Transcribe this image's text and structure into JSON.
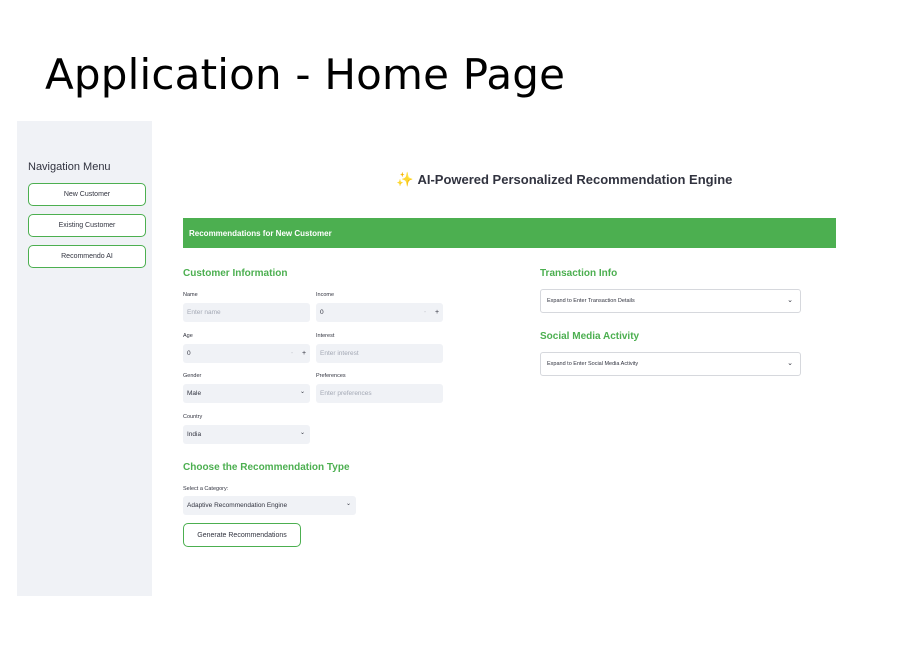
{
  "slide": {
    "title": "Application - Home Page"
  },
  "sidebar": {
    "heading": "Navigation Menu",
    "items": [
      {
        "label": "New Customer"
      },
      {
        "label": "Existing Customer"
      },
      {
        "label": "Recommendo AI"
      }
    ]
  },
  "header": {
    "sparkle": "✨",
    "title": "AI-Powered Personalized Recommendation Engine"
  },
  "banner": {
    "text": "Recommendations for New Customer"
  },
  "customer_info": {
    "title": "Customer Information",
    "name": {
      "label": "Name",
      "placeholder": "Enter name"
    },
    "income": {
      "label": "Income",
      "value": "0"
    },
    "age": {
      "label": "Age",
      "value": "0"
    },
    "interest": {
      "label": "Interest",
      "placeholder": "Enter interest"
    },
    "gender": {
      "label": "Gender",
      "value": "Male"
    },
    "preferences": {
      "label": "Preferences",
      "placeholder": "Enter preferences"
    },
    "country": {
      "label": "Country",
      "value": "India"
    }
  },
  "stepper": {
    "minus": "-",
    "plus": "+"
  },
  "recommendation_type": {
    "title": "Choose the Recommendation Type",
    "category_label": "Select a Category:",
    "category_value": "Adaptive Recommendation Engine"
  },
  "generate_button": {
    "label": "Generate Recommendations"
  },
  "transaction": {
    "title": "Transaction Info",
    "expander": "Expand to Enter Transaction Details"
  },
  "social": {
    "title": "Social Media Activity",
    "expander": "Expand to Enter Social Media Activity"
  },
  "icons": {
    "chevron": "chevron-down-icon"
  },
  "colors": {
    "accent": "#4caf50",
    "sidebar_bg": "#f0f2f6",
    "input_bg": "#f0f2f6",
    "text": "#31333f"
  }
}
